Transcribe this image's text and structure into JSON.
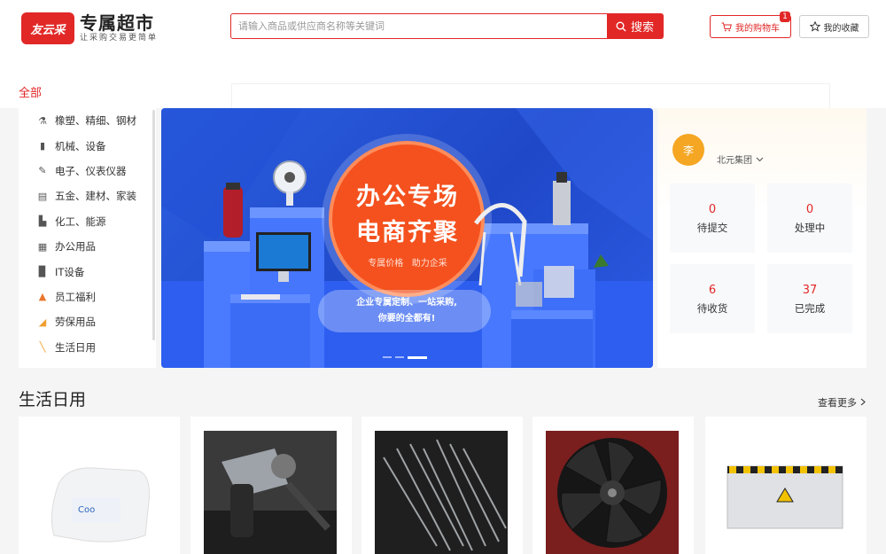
{
  "header": {
    "logo_badge": "友云采",
    "logo_title": "专属超市",
    "logo_subtitle": "让采购交易更简单",
    "search_placeholder": "请输入商品或供应商名称等关键词",
    "search_button": "搜索",
    "cart_label": "我的购物车",
    "cart_count": "1",
    "favorites_label": "我的收藏"
  },
  "nav": {
    "all_label": "全部"
  },
  "categories": [
    {
      "label": "橡塑、精细、钢材",
      "icon": "chemical-icon"
    },
    {
      "label": "机械、设备",
      "icon": "document-icon"
    },
    {
      "label": "电子、仪表仪器",
      "icon": "pen-icon"
    },
    {
      "label": "五金、建材、家装",
      "icon": "printer-icon"
    },
    {
      "label": "化工、能源",
      "icon": "flask-icon"
    },
    {
      "label": "办公用品",
      "icon": "office-icon"
    },
    {
      "label": "IT设备",
      "icon": "computer-icon"
    },
    {
      "label": "员工福利",
      "icon": "gift-icon"
    },
    {
      "label": "劳保用品",
      "icon": "safety-icon"
    },
    {
      "label": "生活日用",
      "icon": "brush-icon"
    }
  ],
  "banner": {
    "title_line1": "办公专场",
    "title_line2": "电商齐聚",
    "tagline": "专属价格   助力企采",
    "slogan_line1": "企业专属定制、一站采购,",
    "slogan_line2": "你要的全都有!",
    "active_slide": 3,
    "slide_count": 3
  },
  "user": {
    "avatar_text": "李",
    "company": "北元集团",
    "stats": [
      {
        "count": "0",
        "label": "待提交"
      },
      {
        "count": "0",
        "label": "处理中"
      },
      {
        "count": "6",
        "label": "待收货"
      },
      {
        "count": "37",
        "label": "已完成"
      }
    ]
  },
  "section": {
    "title": "生活日用",
    "more_label": "查看更多"
  },
  "products": [
    {
      "name": "wipes-product"
    },
    {
      "name": "blower-product"
    },
    {
      "name": "brush-strip-product"
    },
    {
      "name": "fan-product"
    },
    {
      "name": "flood-barrier-product"
    }
  ],
  "colors": {
    "accent": "#e22727",
    "banner_blue": "#2b5fe0",
    "banner_orange": "#f4511e"
  }
}
